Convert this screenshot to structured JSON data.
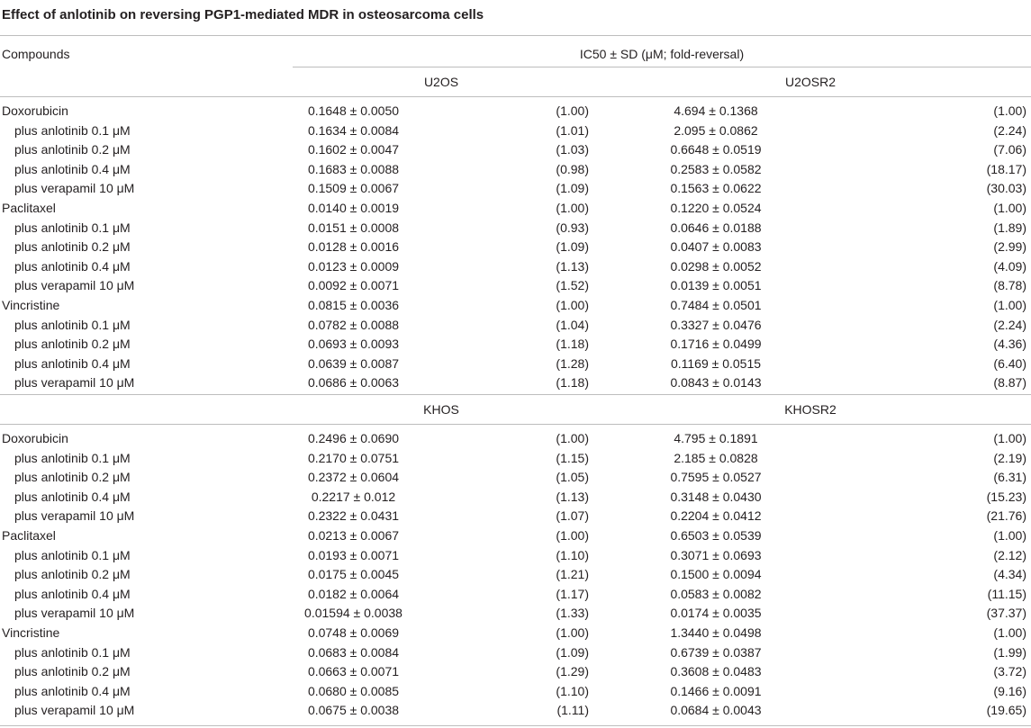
{
  "title": "Effect of anlotinib on reversing PGP1-mediated MDR in osteosarcoma cells",
  "header": {
    "compounds": "Compounds",
    "ic50": "IC50 ± SD (μM; fold-reversal)"
  },
  "sections": [
    {
      "cell_a": "U2OS",
      "cell_b": "U2OSR2",
      "rows": [
        {
          "name": "Doxorubicin",
          "sub": false,
          "a": "0.1648 ± 0.0050",
          "af": "(1.00)",
          "b": "4.694 ± 0.1368",
          "bf": "(1.00)"
        },
        {
          "name": "plus anlotinib 0.1 μM",
          "sub": true,
          "a": "0.1634 ± 0.0084",
          "af": "(1.01)",
          "b": "2.095 ± 0.0862",
          "bf": "(2.24)"
        },
        {
          "name": "plus anlotinib 0.2 μM",
          "sub": true,
          "a": "0.1602 ± 0.0047",
          "af": "(1.03)",
          "b": "0.6648 ± 0.0519",
          "bf": "(7.06)"
        },
        {
          "name": "plus anlotinib 0.4 μM",
          "sub": true,
          "a": "0.1683 ± 0.0088",
          "af": "(0.98)",
          "b": "0.2583 ± 0.0582",
          "bf": "(18.17)"
        },
        {
          "name": "plus verapamil 10 μM",
          "sub": true,
          "a": "0.1509 ± 0.0067",
          "af": "(1.09)",
          "b": "0.1563 ± 0.0622",
          "bf": "(30.03)"
        },
        {
          "name": "Paclitaxel",
          "sub": false,
          "a": "0.0140 ± 0.0019",
          "af": "(1.00)",
          "b": "0.1220 ± 0.0524",
          "bf": "(1.00)"
        },
        {
          "name": "plus anlotinib 0.1 μM",
          "sub": true,
          "a": "0.0151 ± 0.0008",
          "af": "(0.93)",
          "b": "0.0646 ± 0.0188",
          "bf": "(1.89)"
        },
        {
          "name": "plus anlotinib 0.2 μM",
          "sub": true,
          "a": "0.0128 ± 0.0016",
          "af": "(1.09)",
          "b": "0.0407 ± 0.0083",
          "bf": "(2.99)"
        },
        {
          "name": "plus anlotinib 0.4 μM",
          "sub": true,
          "a": "0.0123 ± 0.0009",
          "af": "(1.13)",
          "b": "0.0298 ± 0.0052",
          "bf": "(4.09)"
        },
        {
          "name": "plus verapamil 10 μM",
          "sub": true,
          "a": "0.0092 ± 0.0071",
          "af": "(1.52)",
          "b": "0.0139 ± 0.0051",
          "bf": "(8.78)"
        },
        {
          "name": "Vincristine",
          "sub": false,
          "a": "0.0815 ± 0.0036",
          "af": "(1.00)",
          "b": "0.7484 ± 0.0501",
          "bf": "(1.00)"
        },
        {
          "name": "plus anlotinib 0.1 μM",
          "sub": true,
          "a": "0.0782 ± 0.0088",
          "af": "(1.04)",
          "b": "0.3327 ± 0.0476",
          "bf": "(2.24)"
        },
        {
          "name": "plus anlotinib 0.2 μM",
          "sub": true,
          "a": "0.0693 ± 0.0093",
          "af": "(1.18)",
          "b": "0.1716 ± 0.0499",
          "bf": "(4.36)"
        },
        {
          "name": "plus anlotinib 0.4 μM",
          "sub": true,
          "a": "0.0639 ± 0.0087",
          "af": "(1.28)",
          "b": "0.1169 ± 0.0515",
          "bf": "(6.40)"
        },
        {
          "name": "plus verapamil 10 μM",
          "sub": true,
          "a": "0.0686 ± 0.0063",
          "af": "(1.18)",
          "b": "0.0843 ± 0.0143",
          "bf": "(8.87)"
        }
      ]
    },
    {
      "cell_a": "KHOS",
      "cell_b": "KHOSR2",
      "rows": [
        {
          "name": "Doxorubicin",
          "sub": false,
          "a": "0.2496 ± 0.0690",
          "af": "(1.00)",
          "b": "4.795 ± 0.1891",
          "bf": "(1.00)"
        },
        {
          "name": "plus anlotinib 0.1 μM",
          "sub": true,
          "a": "0.2170 ± 0.0751",
          "af": "(1.15)",
          "b": "2.185 ± 0.0828",
          "bf": "(2.19)"
        },
        {
          "name": "plus anlotinib 0.2 μM",
          "sub": true,
          "a": "0.2372 ± 0.0604",
          "af": "(1.05)",
          "b": "0.7595 ± 0.0527",
          "bf": "(6.31)"
        },
        {
          "name": "plus anlotinib 0.4 μM",
          "sub": true,
          "a": "0.2217 ± 0.012",
          "af": "(1.13)",
          "b": "0.3148 ± 0.0430",
          "bf": "(15.23)"
        },
        {
          "name": "plus verapamil 10 μM",
          "sub": true,
          "a": "0.2322 ± 0.0431",
          "af": "(1.07)",
          "b": "0.2204 ± 0.0412",
          "bf": "(21.76)"
        },
        {
          "name": "Paclitaxel",
          "sub": false,
          "a": "0.0213 ± 0.0067",
          "af": "(1.00)",
          "b": "0.6503 ± 0.0539",
          "bf": "(1.00)"
        },
        {
          "name": "plus anlotinib 0.1 μM",
          "sub": true,
          "a": "0.0193 ± 0.0071",
          "af": "(1.10)",
          "b": "0.3071 ± 0.0693",
          "bf": "(2.12)"
        },
        {
          "name": "plus anlotinib 0.2 μM",
          "sub": true,
          "a": "0.0175 ± 0.0045",
          "af": "(1.21)",
          "b": "0.1500 ± 0.0094",
          "bf": "(4.34)"
        },
        {
          "name": "plus anlotinib 0.4 μM",
          "sub": true,
          "a": "0.0182 ± 0.0064",
          "af": "(1.17)",
          "b": "0.0583 ± 0.0082",
          "bf": "(11.15)"
        },
        {
          "name": "plus verapamil 10 μM",
          "sub": true,
          "a": "0.01594 ± 0.0038",
          "af": "(1.33)",
          "b": "0.0174 ± 0.0035",
          "bf": "(37.37)"
        },
        {
          "name": "Vincristine",
          "sub": false,
          "a": "0.0748 ± 0.0069",
          "af": "(1.00)",
          "b": "1.3440 ± 0.0498",
          "bf": "(1.00)"
        },
        {
          "name": "plus anlotinib 0.1 μM",
          "sub": true,
          "a": "0.0683 ± 0.0084",
          "af": "(1.09)",
          "b": "0.6739 ± 0.0387",
          "bf": "(1.99)"
        },
        {
          "name": "plus anlotinib 0.2 μM",
          "sub": true,
          "a": "0.0663 ± 0.0071",
          "af": "(1.29)",
          "b": "0.3608 ± 0.0483",
          "bf": "(3.72)"
        },
        {
          "name": "plus anlotinib 0.4 μM",
          "sub": true,
          "a": "0.0680 ± 0.0085",
          "af": "(1.10)",
          "b": "0.1466 ± 0.0091",
          "bf": "(9.16)"
        },
        {
          "name": "plus verapamil 10 μM",
          "sub": true,
          "a": "0.0675 ± 0.0038",
          "af": "(1.11)",
          "b": "0.0684 ± 0.0043",
          "bf": "(19.65)"
        }
      ]
    }
  ]
}
